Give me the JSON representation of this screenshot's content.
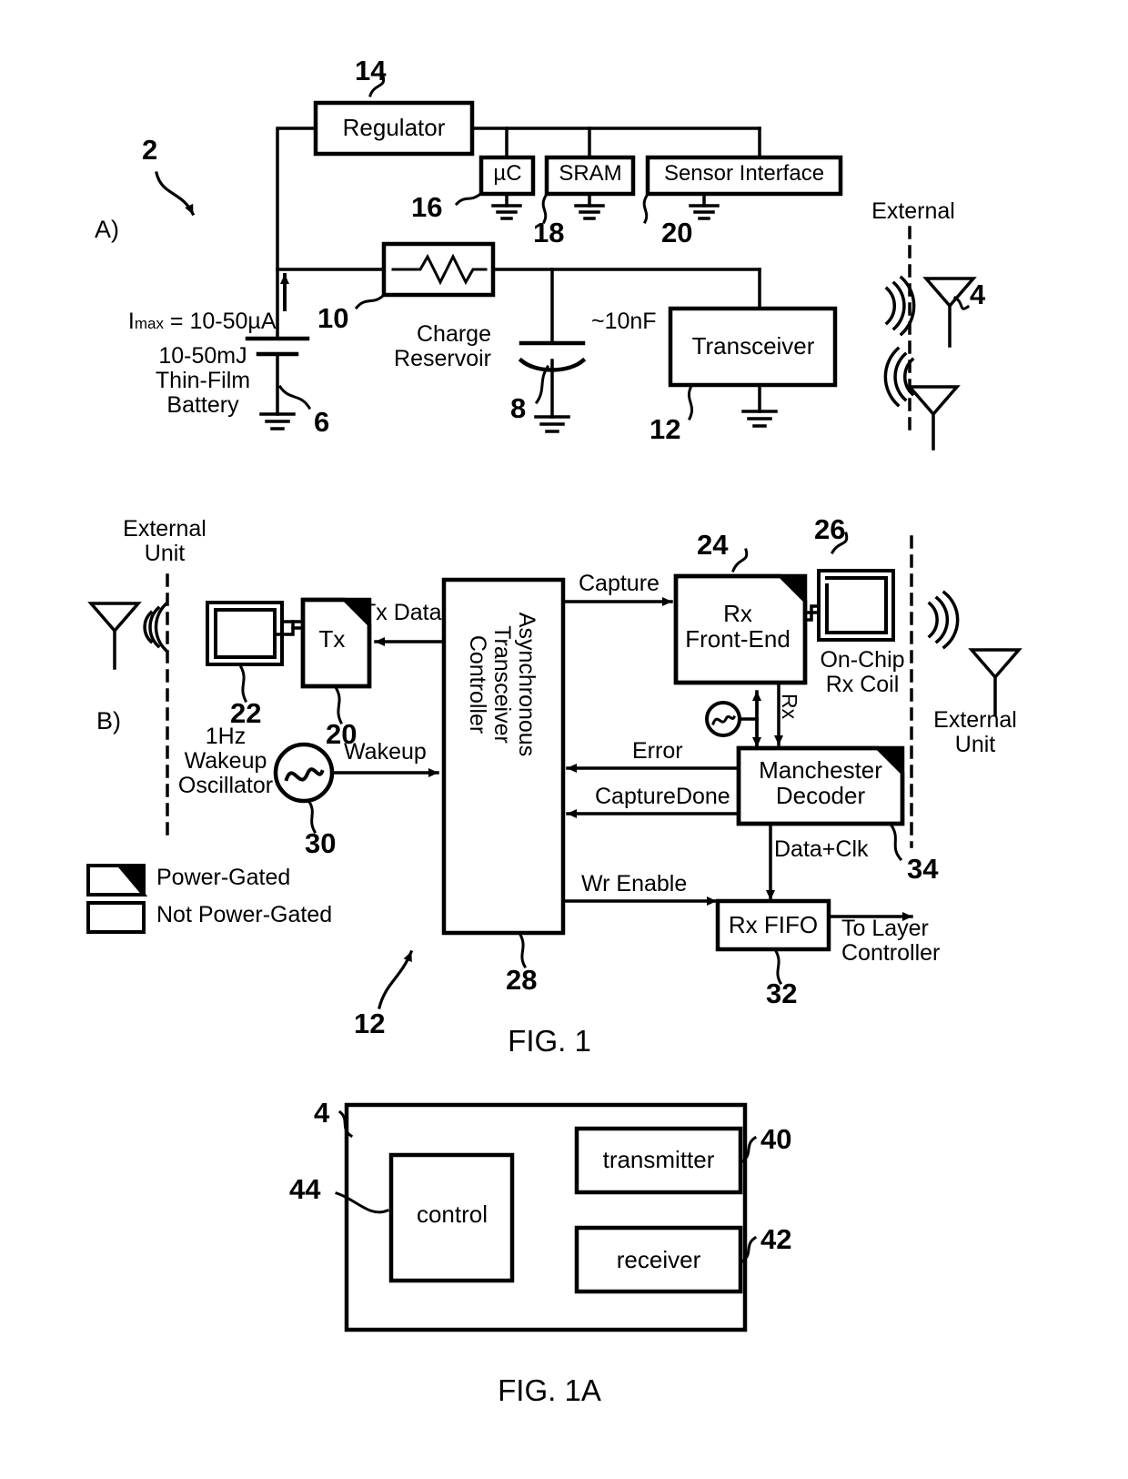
{
  "figure": {
    "title_main": "FIG. 1",
    "title_sub": "FIG. 1A"
  },
  "panel_a": {
    "label": "A)",
    "ref_system": "2",
    "blocks": {
      "regulator": {
        "label": "Regulator",
        "ref": "14"
      },
      "uc": {
        "label": "µC",
        "ref": "16"
      },
      "sram": {
        "label": "SRAM",
        "ref": "18"
      },
      "sensor_interface": {
        "label": "Sensor Interface",
        "ref": "20"
      },
      "resistor": {
        "ref": "10"
      },
      "capacitor": {
        "label": "Charge\nReservoir",
        "value": "~10nF",
        "ref": "8"
      },
      "transceiver": {
        "label": "Transceiver",
        "ref": "12"
      },
      "battery": {
        "label": "10-50mJ\nThin-Film\nBattery",
        "ref": "6"
      }
    },
    "annotations": {
      "imax": "I",
      "imax_sub": "max",
      "imax_rest": " = 10-50µA",
      "external": "External",
      "antenna_ref": "4"
    }
  },
  "panel_b": {
    "label": "B)",
    "ref_system": "12",
    "external_unit_left": "External\nUnit",
    "external_unit_right": "External\nUnit",
    "blocks": {
      "tx_coil": {
        "ref": "22"
      },
      "tx": {
        "label": "Tx",
        "ref": "20"
      },
      "controller": {
        "label": "Asynchronous\nTransceiver\nController",
        "ref": "28"
      },
      "rx_front_end": {
        "label": "Rx\nFront-End",
        "ref": "24"
      },
      "rx_coil": {
        "label": "On-Chip\nRx Coil",
        "ref": "26"
      },
      "manchester_decoder": {
        "label": "Manchester\nDecoder",
        "ref": "34"
      },
      "rx_fifo": {
        "label": "Rx FIFO",
        "ref": "32"
      },
      "oscillator": {
        "label": "1Hz\nWakeup\nOscillator",
        "ref": "30"
      }
    },
    "signals": {
      "tx_data": "Tx Data",
      "wakeup": "Wakeup",
      "capture": "Capture",
      "error": "Error",
      "capture_done": "CaptureDone",
      "wr_enable": "Wr Enable",
      "data_clk": "Data+Clk",
      "rx": "Rx",
      "to_layer_controller": "To Layer\nController"
    },
    "legend": [
      {
        "label": "Power-Gated",
        "gated": true
      },
      {
        "label": "Not Power-Gated",
        "gated": false
      }
    ]
  },
  "panel_1a": {
    "outer_ref": "4",
    "blocks": {
      "control": {
        "label": "control",
        "ref": "44"
      },
      "transmitter": {
        "label": "transmitter",
        "ref": "40"
      },
      "receiver": {
        "label": "receiver",
        "ref": "42"
      }
    }
  },
  "style": {
    "ink": "#000000",
    "paper": "#ffffff"
  }
}
